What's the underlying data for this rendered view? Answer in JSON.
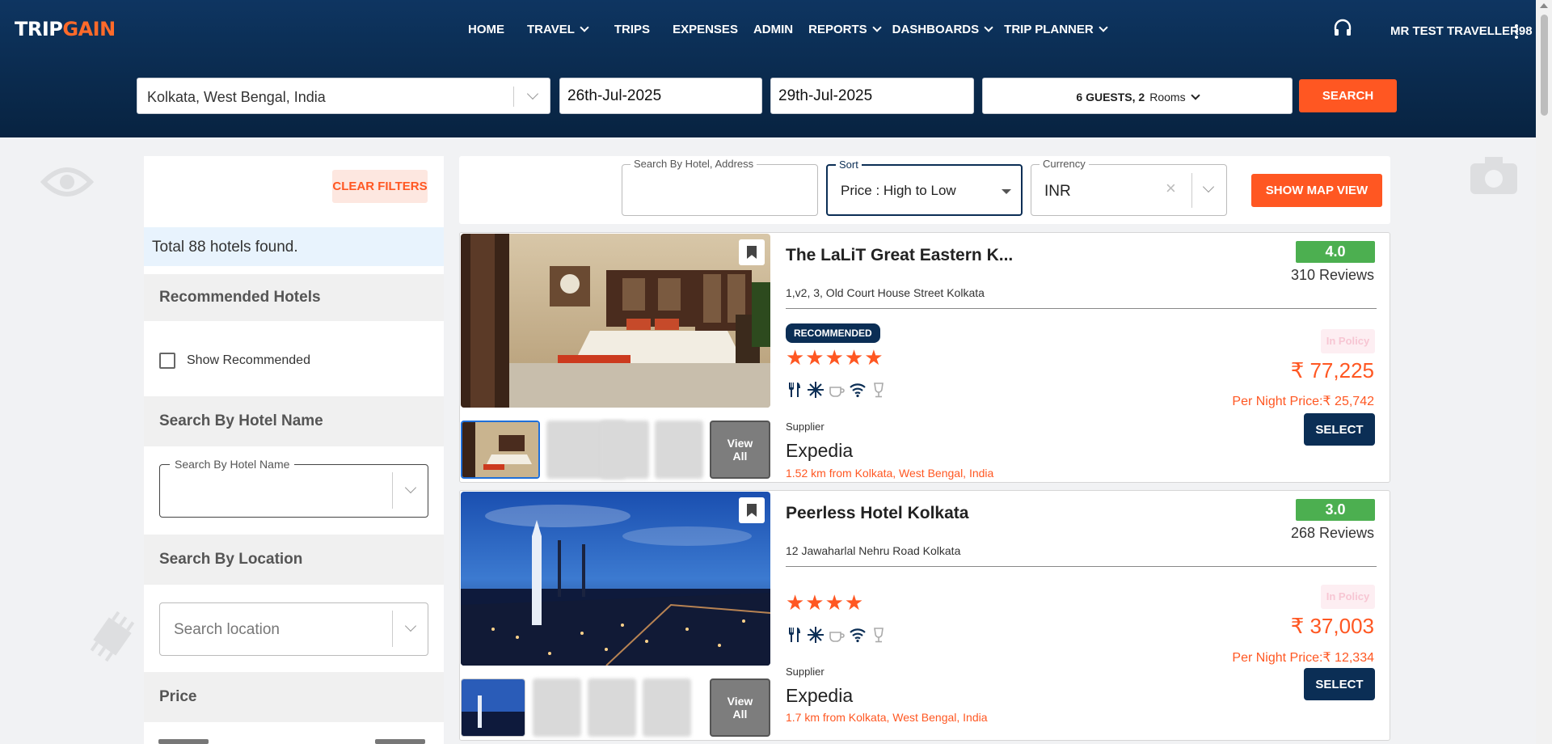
{
  "brand": {
    "trip": "TRIP",
    "gain": "GAIN"
  },
  "nav": [
    {
      "label": "HOME",
      "dropdown": false
    },
    {
      "label": "TRAVEL",
      "dropdown": true
    },
    {
      "label": "TRIPS",
      "dropdown": false
    },
    {
      "label": "EXPENSES",
      "dropdown": false
    },
    {
      "label": "ADMIN",
      "dropdown": false
    },
    {
      "label": "REPORTS",
      "dropdown": true
    },
    {
      "label": "DASHBOARDS",
      "dropdown": true
    },
    {
      "label": "TRIP PLANNER",
      "dropdown": true
    }
  ],
  "user": {
    "name": "MR TEST TRAVELLER98"
  },
  "search": {
    "destination": "Kolkata, West Bengal, India",
    "checkin": "26th-Jul-2025",
    "checkout": "29th-Jul-2025",
    "guests": "6 GUESTS, 2",
    "rooms_label": "Rooms",
    "button": "SEARCH"
  },
  "sidebar": {
    "clear_filters": "CLEAR FILTERS",
    "total": "Total 88 hotels found.",
    "recommended_title": "Recommended Hotels",
    "show_recommended": "Show Recommended",
    "hotel_name_title": "Search By Hotel Name",
    "hotel_name_legend": "Search By Hotel Name",
    "location_title": "Search By Location",
    "location_placeholder": "Search location",
    "price_title": "Price"
  },
  "filters": {
    "search_legend": "Search By Hotel, Address",
    "sort_legend": "Sort",
    "sort_value": "Price : High to Low",
    "currency_legend": "Currency",
    "currency_value": "INR",
    "map_button": "SHOW MAP VIEW"
  },
  "hotels": [
    {
      "name": "The LaLiT Great Eastern K...",
      "address": "1,v2, 3, Old Court House Street Kolkata",
      "rating": "4.0",
      "reviews": "310 Reviews",
      "recommended": "RECOMMENDED",
      "stars": "★★★★★",
      "policy": "In Policy",
      "price": "₹ 77,225",
      "per_night": "Per Night Price:₹ 25,742",
      "select": "SELECT",
      "supplier_label": "Supplier",
      "supplier": "Expedia",
      "distance": "1.52 km from Kolkata, West Bengal, India",
      "view_all": "View All"
    },
    {
      "name": "Peerless Hotel Kolkata",
      "address": "12 Jawaharlal Nehru Road Kolkata",
      "rating": "3.0",
      "reviews": "268 Reviews",
      "stars": "★★★★",
      "policy": "In Policy",
      "price": "₹ 37,003",
      "per_night": "Per Night Price:₹ 12,334",
      "select": "SELECT",
      "supplier_label": "Supplier",
      "supplier": "Expedia",
      "distance": "1.7 km from Kolkata, West Bengal, India",
      "view_all": "View All"
    }
  ],
  "amenity_icons": [
    "restaurant-icon",
    "ac-icon",
    "coffee-icon",
    "wifi-icon",
    "bar-icon"
  ],
  "colors": {
    "accent": "#ff5722",
    "navy": "#0b2e55",
    "rating_green": "#4caf50"
  }
}
